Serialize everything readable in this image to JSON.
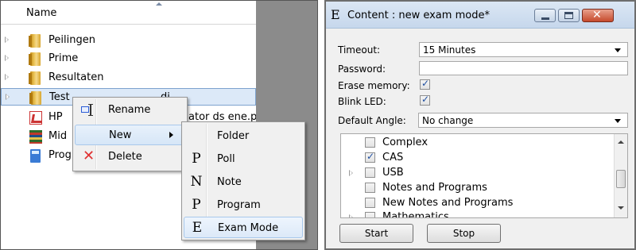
{
  "explorer": {
    "header": {
      "name_label": "Name"
    },
    "items": [
      {
        "label": "Peilingen",
        "icon": "folder-icon"
      },
      {
        "label": "Prime",
        "icon": "folder-icon"
      },
      {
        "label": "Resultaten",
        "icon": "folder-icon"
      },
      {
        "label": "Test",
        "icon": "folder-icon",
        "selected": true,
        "trailing": "di"
      },
      {
        "label": "HP",
        "trailing": "ator ds ene.p",
        "icon": "pdf-icon"
      },
      {
        "label": "Mid",
        "icon": "books-icon"
      },
      {
        "label": "Prog",
        "icon": "calculator-icon"
      }
    ]
  },
  "context_menu": {
    "items": [
      {
        "label": "Rename",
        "icon": "rename-icon"
      },
      {
        "label": "New",
        "icon": "",
        "has_submenu": true
      },
      {
        "label": "Delete",
        "icon": "delete-icon"
      }
    ]
  },
  "new_submenu": {
    "items": [
      {
        "label": "Folder",
        "glyph": ""
      },
      {
        "label": "Poll",
        "glyph": "P"
      },
      {
        "label": "Note",
        "glyph": "N"
      },
      {
        "label": "Program",
        "glyph": "P"
      },
      {
        "label": "Exam Mode",
        "glyph": "E"
      }
    ]
  },
  "dialog": {
    "app_glyph": "E",
    "title": "Content : new exam mode*",
    "timeout": {
      "label": "Timeout:",
      "value": "15 Minutes"
    },
    "password": {
      "label": "Password:",
      "value": ""
    },
    "erase_memory": {
      "label": "Erase memory:",
      "checked": true
    },
    "blink_led": {
      "label": "Blink LED:",
      "checked": true
    },
    "default_angle": {
      "label": "Default Angle:",
      "value": "No change"
    },
    "options": [
      {
        "label": "Complex",
        "checked": false,
        "expandable": false
      },
      {
        "label": "CAS",
        "checked": true,
        "expandable": false
      },
      {
        "label": "USB",
        "checked": false,
        "expandable": true
      },
      {
        "label": "Notes and Programs",
        "checked": false,
        "expandable": false
      },
      {
        "label": "New Notes and Programs",
        "checked": false,
        "expandable": false
      },
      {
        "label": "Mathematics",
        "checked": false,
        "expandable": true
      }
    ],
    "start_label": "Start",
    "stop_label": "Stop"
  },
  "colors": {
    "selection_bg": "#dce9f8",
    "menu_bg": "#f0f0f0",
    "close_button": "#c64a2c",
    "scrollbar_gray": "#8b8b8b"
  }
}
